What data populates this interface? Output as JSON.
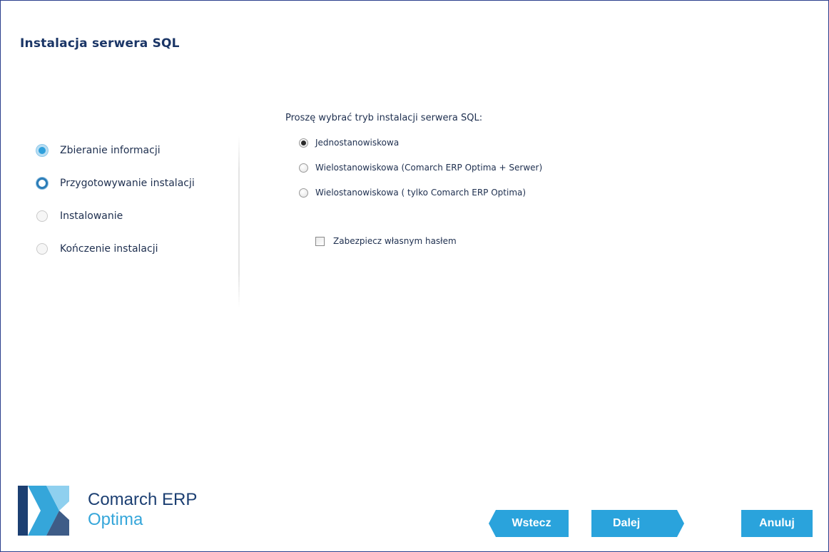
{
  "window": {
    "title": "Instalacja serwera SQL"
  },
  "steps": [
    {
      "label": "Zbieranie informacji",
      "state": "done"
    },
    {
      "label": "Przygotowywanie instalacji",
      "state": "current"
    },
    {
      "label": "Instalowanie",
      "state": "todo"
    },
    {
      "label": "Kończenie instalacji",
      "state": "todo"
    }
  ],
  "form": {
    "prompt": "Proszę wybrać tryb instalacji serwera SQL:",
    "options": [
      {
        "label": "Jednostanowiskowa",
        "checked": true
      },
      {
        "label": "Wielostanowiskowa (Comarch ERP Optima + Serwer)",
        "checked": false
      },
      {
        "label": "Wielostanowiskowa ( tylko Comarch ERP Optima)",
        "checked": false
      }
    ],
    "password_checkbox": {
      "label": "Zabezpiecz własnym hasłem",
      "checked": false
    }
  },
  "brand": {
    "line1": "Comarch ERP",
    "line2": "Optima"
  },
  "buttons": {
    "back": "Wstecz",
    "next": "Dalej",
    "cancel": "Anuluj"
  },
  "colors": {
    "accent": "#2aa3dc",
    "title": "#1a3566",
    "border": "#2b3f8c"
  }
}
